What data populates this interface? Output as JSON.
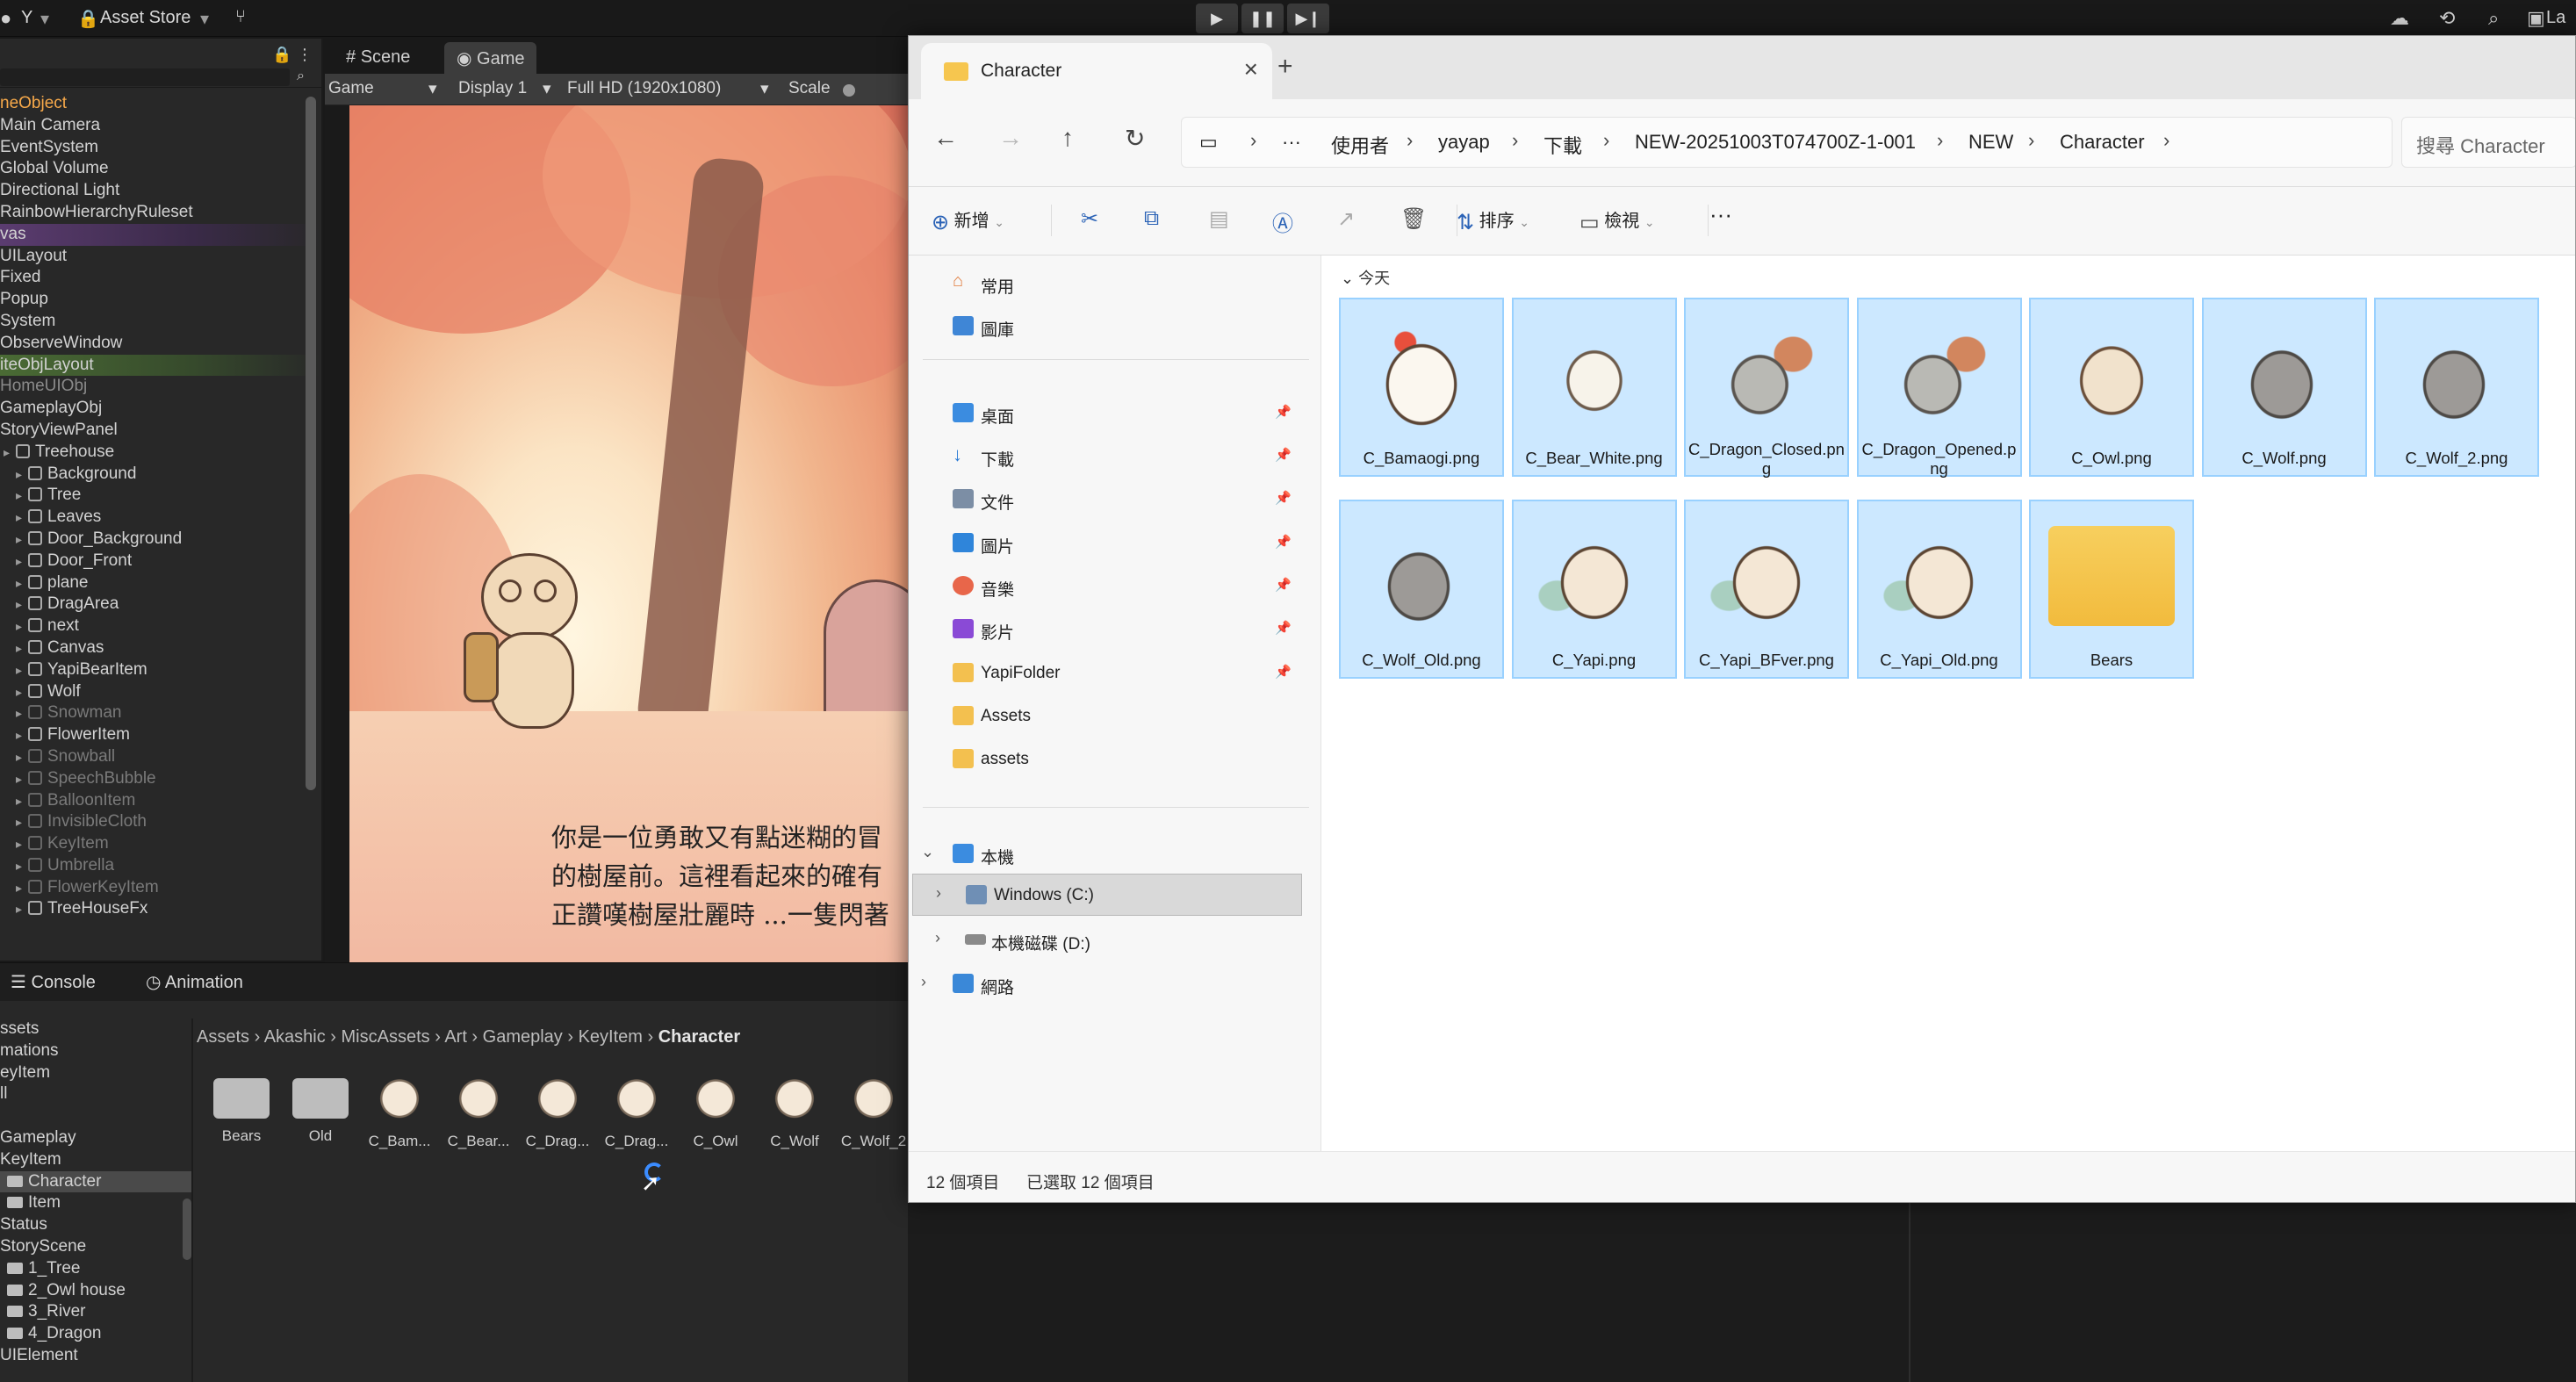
{
  "toolbar": {
    "account": "Y",
    "asset_store": "Asset Store",
    "right_label": "La"
  },
  "hierarchy": {
    "rows": [
      {
        "label": "neObject",
        "color": "#f7a94a",
        "indent": 0
      },
      {
        "label": "Main Camera",
        "color": "#d2d2d2",
        "indent": 0
      },
      {
        "label": "EventSystem",
        "color": "#d2d2d2",
        "indent": 0
      },
      {
        "label": "Global Volume",
        "color": "#d2d2d2",
        "indent": 0
      },
      {
        "label": "Directional Light",
        "color": "#d2d2d2",
        "indent": 0
      },
      {
        "label": "RainbowHierarchyRuleset",
        "color": "#d2d2d2",
        "indent": 0
      },
      {
        "label": "vas",
        "color": "#d2d2d2",
        "indent": 0
      },
      {
        "label": "UILayout",
        "color": "#d2d2d2",
        "indent": 0
      },
      {
        "label": "Fixed",
        "color": "#d2d2d2",
        "indent": 0
      },
      {
        "label": "Popup",
        "color": "#d2d2d2",
        "indent": 0
      },
      {
        "label": "System",
        "color": "#d2d2d2",
        "indent": 0
      },
      {
        "label": "ObserveWindow",
        "color": "#d2d2d2",
        "indent": 0
      },
      {
        "label": "iteObjLayout",
        "color": "#d2d2d2",
        "indent": 0
      },
      {
        "label": "HomeUIObj",
        "color": "#8a8a8a",
        "indent": 0
      },
      {
        "label": "GameplayObj",
        "color": "#d2d2d2",
        "indent": 0
      },
      {
        "label": "StoryViewPanel",
        "color": "#d2d2d2",
        "indent": 0
      },
      {
        "label": "Treehouse",
        "color": "#d2d2d2",
        "indent": 1
      },
      {
        "label": "Background",
        "color": "#d2d2d2",
        "indent": 2
      },
      {
        "label": "Tree",
        "color": "#d2d2d2",
        "indent": 2
      },
      {
        "label": "Leaves",
        "color": "#d2d2d2",
        "indent": 2
      },
      {
        "label": "Door_Background",
        "color": "#d2d2d2",
        "indent": 2
      },
      {
        "label": "Door_Front",
        "color": "#d2d2d2",
        "indent": 2
      },
      {
        "label": "plane",
        "color": "#d2d2d2",
        "indent": 2
      },
      {
        "label": "DragArea",
        "color": "#d2d2d2",
        "indent": 2
      },
      {
        "label": "next",
        "color": "#d2d2d2",
        "indent": 2
      },
      {
        "label": "Canvas",
        "color": "#d2d2d2",
        "indent": 2
      },
      {
        "label": "YapiBearItem",
        "color": "#d2d2d2",
        "indent": 2
      },
      {
        "label": "Wolf",
        "color": "#d2d2d2",
        "indent": 2
      },
      {
        "label": "Snowman",
        "color": "#7a7a7a",
        "indent": 2
      },
      {
        "label": "FlowerItem",
        "color": "#d2d2d2",
        "indent": 2
      },
      {
        "label": "Snowball",
        "color": "#7a7a7a",
        "indent": 2
      },
      {
        "label": "SpeechBubble",
        "color": "#7a7a7a",
        "indent": 2
      },
      {
        "label": "BalloonItem",
        "color": "#7a7a7a",
        "indent": 2
      },
      {
        "label": "InvisibleCloth",
        "color": "#7a7a7a",
        "indent": 2
      },
      {
        "label": "KeyItem",
        "color": "#7a7a7a",
        "indent": 2
      },
      {
        "label": "Umbrella",
        "color": "#7a7a7a",
        "indent": 2
      },
      {
        "label": "FlowerKeyItem",
        "color": "#7a7a7a",
        "indent": 2
      },
      {
        "label": "TreeHouseFx",
        "color": "#d2d2d2",
        "indent": 2
      }
    ]
  },
  "views": {
    "scene_tab": "Scene",
    "game_tab": "Game",
    "game_dropdown": "Game",
    "display": "Display 1",
    "resolution": "Full HD (1920x1080)",
    "scale": "Scale"
  },
  "story": {
    "line1": "你是一位勇敢又有點迷糊的冒",
    "line2": "的樹屋前。這裡看起來的確有",
    "line3": "正讚嘆樹屋壯麗時 ...一隻閃著"
  },
  "console": {
    "console_tab": "Console",
    "animation_tab": "Animation"
  },
  "project": {
    "tree": [
      {
        "label": "ssets",
        "folder": false,
        "selected": false
      },
      {
        "label": "mations",
        "folder": false,
        "selected": false
      },
      {
        "label": "eyItem",
        "folder": false,
        "selected": false
      },
      {
        "label": "ll",
        "folder": false,
        "selected": false
      },
      {
        "label": "",
        "folder": false,
        "selected": false
      },
      {
        "label": "Gameplay",
        "folder": false,
        "selected": false
      },
      {
        "label": "KeyItem",
        "folder": false,
        "selected": false
      },
      {
        "label": "Character",
        "folder": true,
        "selected": true
      },
      {
        "label": "Item",
        "folder": true,
        "selected": false
      },
      {
        "label": "Status",
        "folder": false,
        "selected": false
      },
      {
        "label": "StoryScene",
        "folder": false,
        "selected": false
      },
      {
        "label": "1_Tree",
        "folder": true,
        "selected": false
      },
      {
        "label": "2_Owl house",
        "folder": true,
        "selected": false
      },
      {
        "label": "3_River",
        "folder": true,
        "selected": false
      },
      {
        "label": "4_Dragon",
        "folder": true,
        "selected": false
      },
      {
        "label": "UIElement",
        "folder": false,
        "selected": false
      }
    ],
    "breadcrumbs": [
      "Assets",
      "Akashic",
      "MiscAssets",
      "Art",
      "Gameplay",
      "KeyItem",
      "Character"
    ],
    "assets": [
      {
        "name": "Bears",
        "kind": "folder"
      },
      {
        "name": "Old",
        "kind": "folder"
      },
      {
        "name": "C_Bam...",
        "kind": "sprite"
      },
      {
        "name": "C_Bear...",
        "kind": "sprite"
      },
      {
        "name": "C_Drag...",
        "kind": "sprite"
      },
      {
        "name": "C_Drag...",
        "kind": "sprite"
      },
      {
        "name": "C_Owl",
        "kind": "sprite"
      },
      {
        "name": "C_Wolf",
        "kind": "sprite"
      },
      {
        "name": "C_Wolf_2",
        "kind": "sprite"
      }
    ]
  },
  "explorer": {
    "tab_title": "Character",
    "breadcrumbs": [
      "使用者",
      "yayap",
      "下載",
      "NEW-20251003T074700Z-1-001",
      "NEW",
      "Character"
    ],
    "search_placeholder": "搜尋 Character",
    "commands": {
      "new": "新增",
      "sort": "排序",
      "view": "檢視"
    },
    "nav": {
      "home": "常用",
      "gallery": "圖庫",
      "desktop": "桌面",
      "downloads": "下載",
      "documents": "文件",
      "pictures": "圖片",
      "music": "音樂",
      "videos": "影片",
      "yapifolder": "YapiFolder",
      "assets_upper": "Assets",
      "assets_lower": "assets",
      "this_pc": "本機",
      "drive_c": "Windows (C:)",
      "drive_d": "本機磁碟 (D:)",
      "network": "網路"
    },
    "group_label": "今天",
    "files": [
      {
        "name": "C_Bamaogi.png",
        "art": "chicken"
      },
      {
        "name": "C_Bear_White.png",
        "art": "bear"
      },
      {
        "name": "C_Dragon_Closed.png",
        "art": "dragon"
      },
      {
        "name": "C_Dragon_Opened.png",
        "art": "dragon"
      },
      {
        "name": "C_Owl.png",
        "art": "owl"
      },
      {
        "name": "C_Wolf.png",
        "art": "wolf"
      },
      {
        "name": "C_Wolf_2.png",
        "art": "wolf"
      },
      {
        "name": "C_Wolf_Old.png",
        "art": "wolf"
      },
      {
        "name": "C_Yapi.png",
        "art": "yapi"
      },
      {
        "name": "C_Yapi_BFver.png",
        "art": "yapi"
      },
      {
        "name": "C_Yapi_Old.png",
        "art": "yapi"
      },
      {
        "name": "Bears",
        "art": "folder"
      }
    ],
    "status": {
      "count": "12 個項目",
      "selected": "已選取 12 個項目"
    }
  }
}
